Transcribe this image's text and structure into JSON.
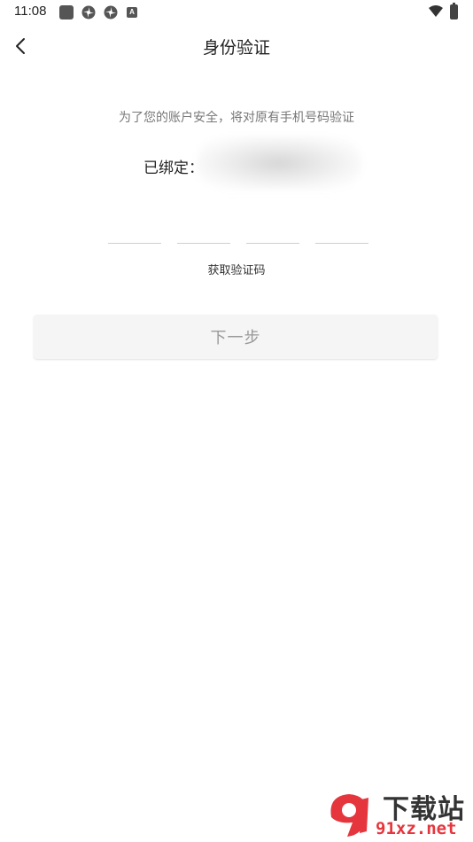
{
  "status_bar": {
    "time": "11:08",
    "icons": [
      "square-icon",
      "pinwheel-icon",
      "pinwheel-icon",
      "a-badge-icon",
      "wifi-icon",
      "battery-icon"
    ],
    "a_badge": "A"
  },
  "header": {
    "title": "身份验证",
    "back_icon": "chevron-left-icon"
  },
  "main": {
    "hint": "为了您的账户安全，将对原有手机号码验证",
    "bound_label": "已绑定：",
    "bound_value_hidden": true,
    "code_inputs": [
      "",
      "",
      "",
      ""
    ],
    "get_code_label": "获取验证码",
    "next_label": "下一步"
  },
  "watermark": {
    "badge": "9",
    "text": "下载站",
    "domain": "91xz.net",
    "accent": "#e5363d"
  }
}
